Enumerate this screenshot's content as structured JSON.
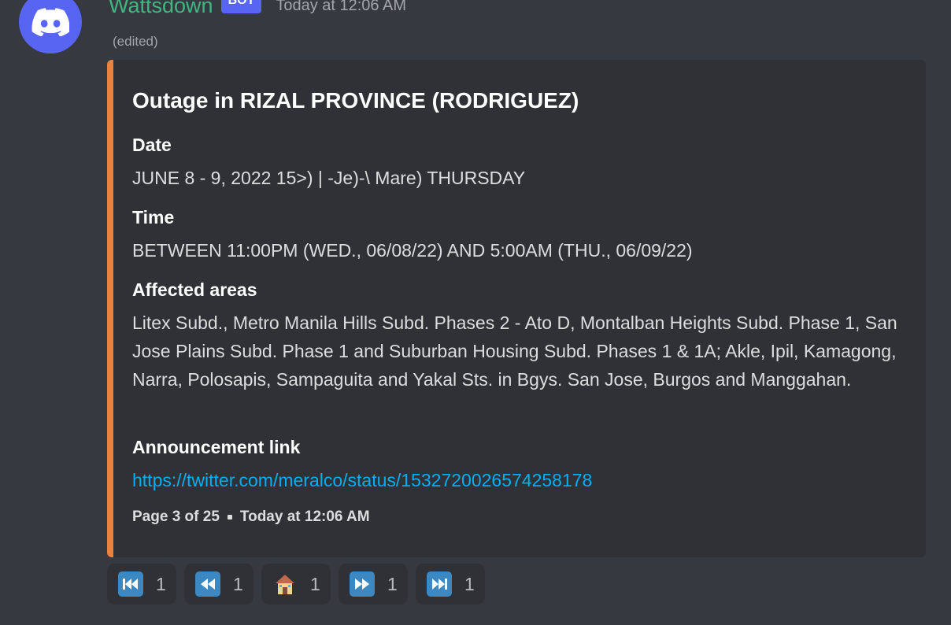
{
  "author": {
    "name": "Wattsdown",
    "badge": "BOT",
    "timestamp": "Today at 12:06 AM",
    "edited": "(edited)",
    "avatar_icon": "discord-logo-icon"
  },
  "colors": {
    "embed_accent": "#e9823d",
    "link": "#00aff4",
    "username": "#43b581",
    "bot_badge": "#5865f2"
  },
  "embed": {
    "title": "Outage in RIZAL PROVINCE (RODRIGUEZ)",
    "fields": [
      {
        "name": "Date",
        "value": "JUNE 8 - 9, 2022 15>) | -Je)-\\ Mare) THURSDAY"
      },
      {
        "name": "Time",
        "value": "BETWEEN 11:00PM (WED., 06/08/22) AND 5:00AM (THU., 06/09/22)"
      },
      {
        "name": "Affected areas",
        "value": "Litex Subd., Metro Manila Hills Subd. Phases 2 - Ato D, Montalban Heights Subd. Phase 1, San Jose Plains Subd. Phase 1 and Suburban Housing Subd. Phases 1 & 1A; Akle, Ipil, Kamagong, Narra, Polosapis, Sampaguita and Yakal Sts. in Bgys. San Jose, Burgos and Manggahan."
      },
      {
        "name": "Announcement link",
        "value": "https://twitter.com/meralco/status/1532720026574258178"
      }
    ],
    "footer": {
      "page": "Page 3 of 25",
      "timestamp": "Today at 12:06 AM"
    }
  },
  "reactions": [
    {
      "icon": "first-page-icon",
      "count": "1"
    },
    {
      "icon": "previous-page-icon",
      "count": "1"
    },
    {
      "icon": "home-icon",
      "count": "1"
    },
    {
      "icon": "next-page-icon",
      "count": "1"
    },
    {
      "icon": "last-page-icon",
      "count": "1"
    }
  ]
}
